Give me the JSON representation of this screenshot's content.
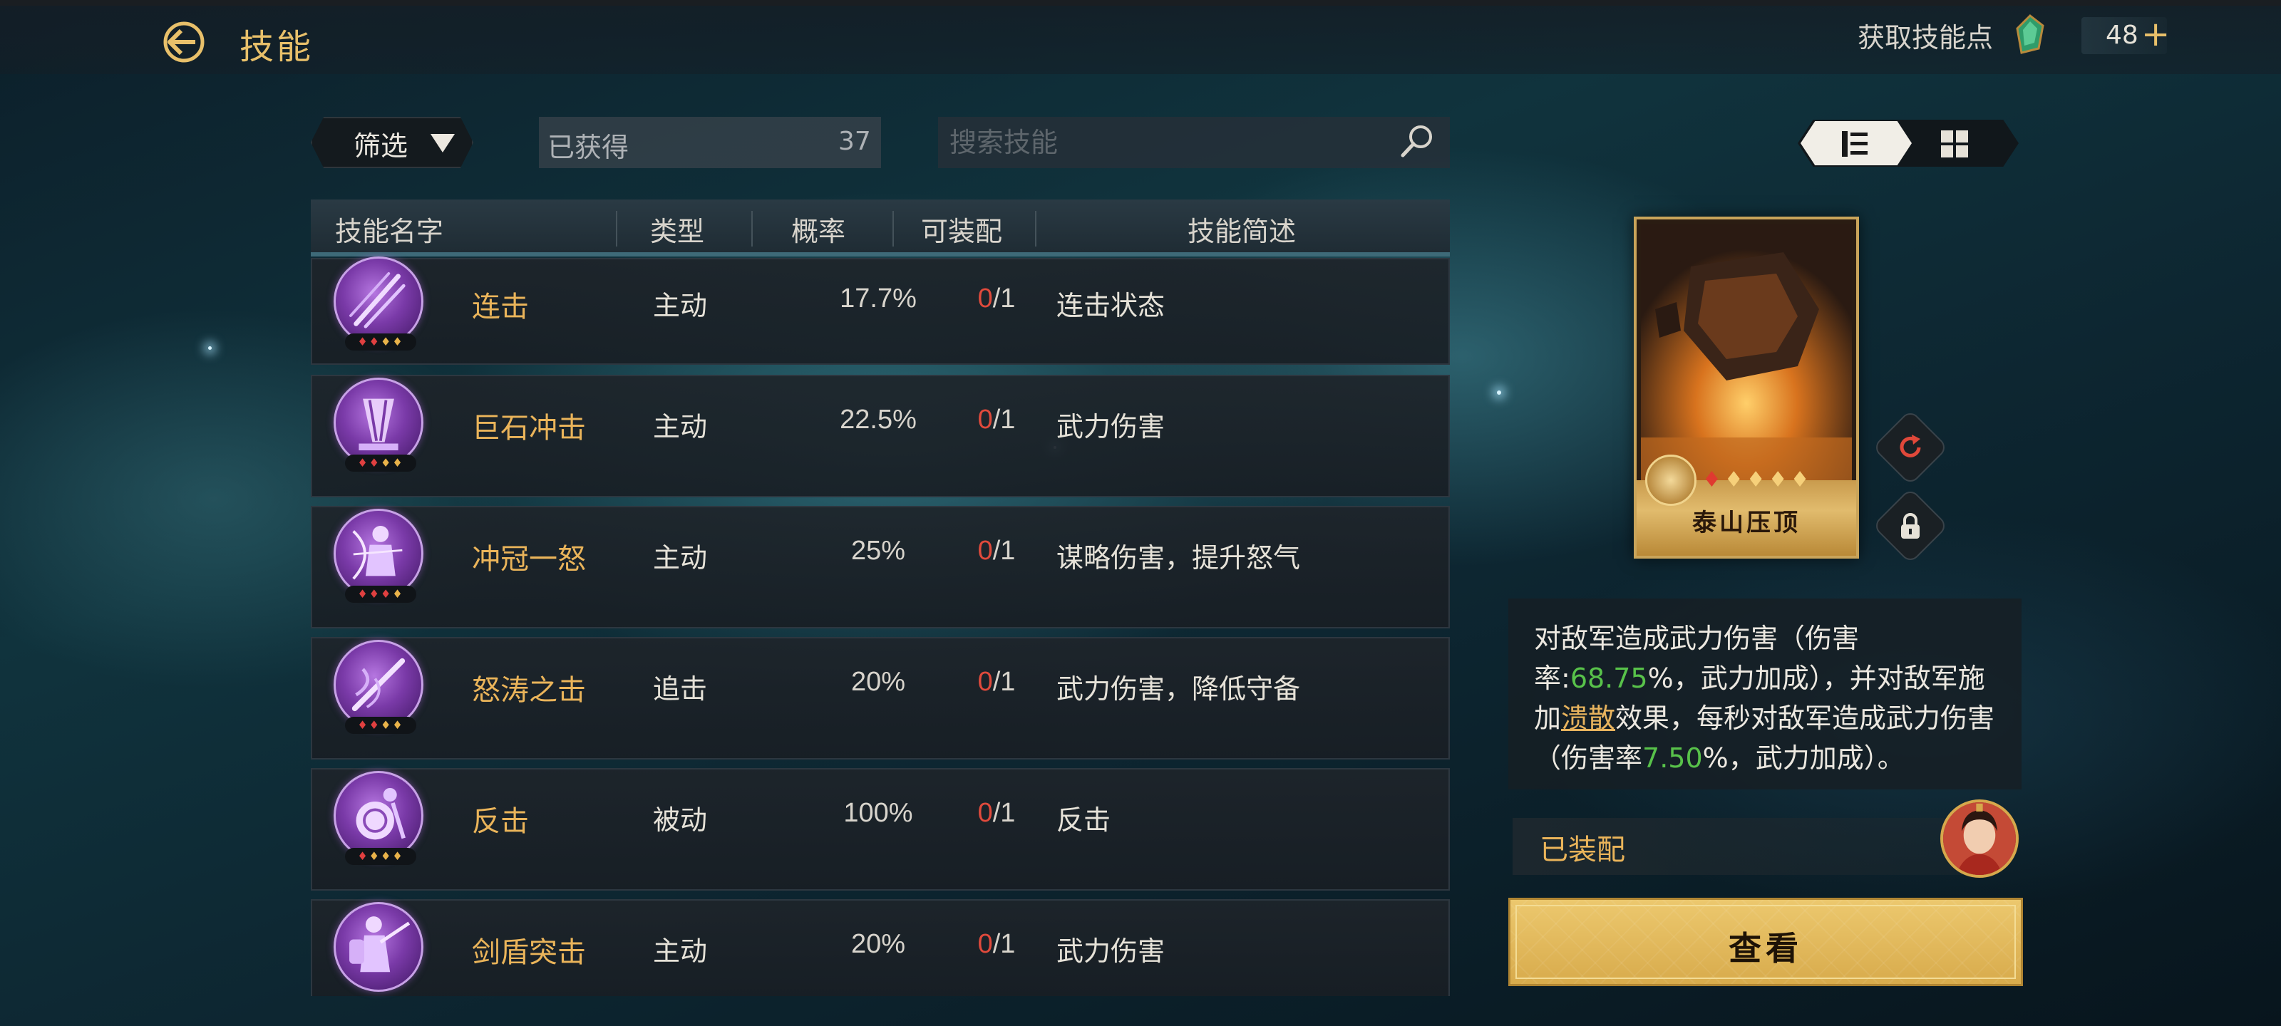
{
  "header": {
    "title": "技能",
    "skill_points_label": "获取技能点",
    "skill_points_value": "48"
  },
  "toolbar": {
    "filter_label": "筛选",
    "owned_label": "已获得",
    "owned_count": "37",
    "search_placeholder": "搜索技能"
  },
  "table": {
    "columns": [
      "技能名字",
      "类型",
      "概率",
      "可装配",
      "技能简述"
    ],
    "rows": [
      {
        "name": "连击",
        "type": "主动",
        "rate": "17.7%",
        "equip_current": "0",
        "equip_total": "/1",
        "desc": "连击状态"
      },
      {
        "name": "巨石冲击",
        "type": "主动",
        "rate": "22.5%",
        "equip_current": "0",
        "equip_total": "/1",
        "desc": "武力伤害"
      },
      {
        "name": "冲冠一怒",
        "type": "主动",
        "rate": "25%",
        "equip_current": "0",
        "equip_total": "/1",
        "desc": "谋略伤害，提升怒气"
      },
      {
        "name": "怒涛之击",
        "type": "追击",
        "rate": "20%",
        "equip_current": "0",
        "equip_total": "/1",
        "desc": "武力伤害，降低守备"
      },
      {
        "name": "反击",
        "type": "被动",
        "rate": "100%",
        "equip_current": "0",
        "equip_total": "/1",
        "desc": "反击"
      },
      {
        "name": "剑盾突击",
        "type": "主动",
        "rate": "20%",
        "equip_current": "0",
        "equip_total": "/1",
        "desc": "武力伤害"
      }
    ]
  },
  "detail": {
    "card_name": "泰山压顶",
    "desc_parts": {
      "p1": "对敌军造成武力伤害（伤害率:",
      "n1": "68.75",
      "p2": "%，武力加成），并对敌军施加",
      "kw": "溃散",
      "p3": "效果，每秒对敌军造成武力伤害（伤害率",
      "n2": "7.50",
      "p4": "%，武力加成）。"
    },
    "equipped_label": "已装配",
    "view_button": "查看"
  },
  "icons": {
    "back": "back-arrow-icon",
    "gem": "emerald-gem-icon",
    "plus": "plus-icon",
    "search": "search-icon",
    "list_view": "list-view-icon",
    "grid_view": "grid-view-icon",
    "refresh": "refresh-icon",
    "lock": "lock-icon"
  },
  "colors": {
    "gold": "#eab45a",
    "red": "#e04a3c",
    "green": "#58c24a",
    "button_gold": "#e1bb62"
  }
}
